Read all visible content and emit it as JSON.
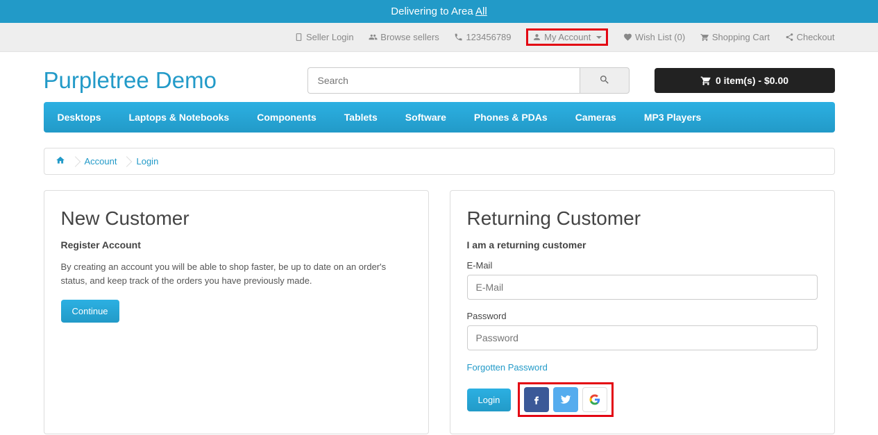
{
  "delivery": {
    "prefix": "Delivering to Area ",
    "area": "All"
  },
  "top": {
    "seller_login": "Seller Login",
    "browse_sellers": "Browse sellers",
    "phone": "123456789",
    "my_account": "My Account",
    "wish_list": "Wish List (0)",
    "shopping_cart": "Shopping Cart",
    "checkout": "Checkout"
  },
  "logo": "Purpletree Demo",
  "search": {
    "placeholder": "Search"
  },
  "cart": {
    "summary": "0 item(s) - $0.00"
  },
  "nav": {
    "desktops": "Desktops",
    "laptops": "Laptops & Notebooks",
    "components": "Components",
    "tablets": "Tablets",
    "software": "Software",
    "phones": "Phones & PDAs",
    "cameras": "Cameras",
    "mp3": "MP3 Players"
  },
  "breadcrumb": {
    "account": "Account",
    "login": "Login"
  },
  "new_customer": {
    "title": "New Customer",
    "subtitle": "Register Account",
    "text": "By creating an account you will be able to shop faster, be up to date on an order's status, and keep track of the orders you have previously made.",
    "continue": "Continue"
  },
  "returning": {
    "title": "Returning Customer",
    "subtitle": "I am a returning customer",
    "email_label": "E-Mail",
    "email_placeholder": "E-Mail",
    "password_label": "Password",
    "password_placeholder": "Password",
    "forgot": "Forgotten Password",
    "login": "Login"
  }
}
